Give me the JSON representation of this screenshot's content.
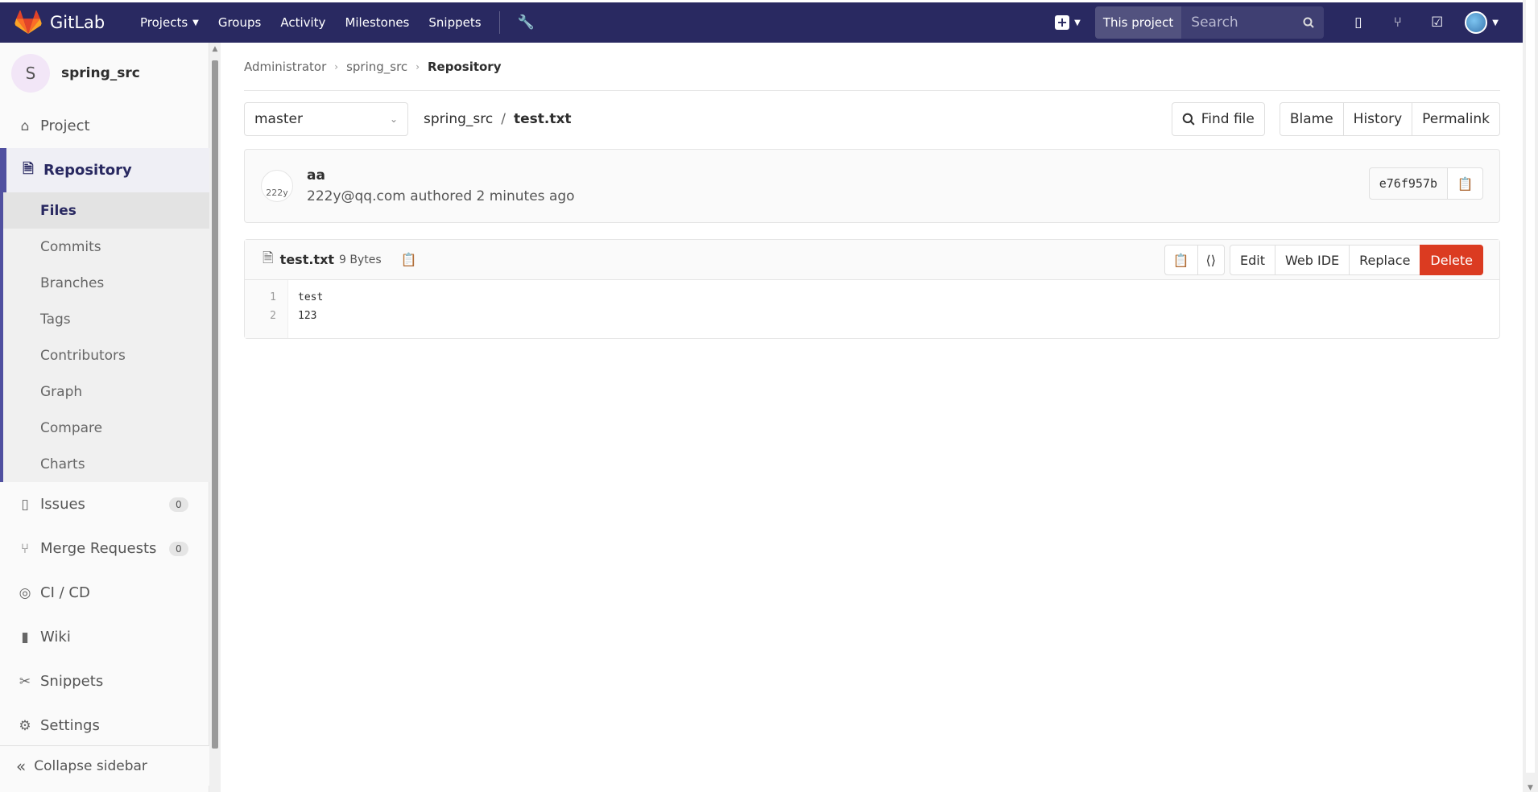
{
  "topnav": {
    "brand": "GitLab",
    "links": [
      {
        "label": "Projects",
        "has_dropdown": true
      },
      {
        "label": "Groups"
      },
      {
        "label": "Activity"
      },
      {
        "label": "Milestones"
      },
      {
        "label": "Snippets"
      }
    ],
    "search_scope": "This project",
    "search_placeholder": "Search"
  },
  "sidebar": {
    "project_avatar": "S",
    "project_name": "spring_src",
    "items": [
      {
        "label": "Project",
        "icon": "home-icon"
      },
      {
        "label": "Repository",
        "icon": "document-icon",
        "active": true
      },
      {
        "label": "Issues",
        "icon": "issues-icon",
        "badge": "0"
      },
      {
        "label": "Merge Requests",
        "icon": "merge-request-icon",
        "badge": "0"
      },
      {
        "label": "CI / CD",
        "icon": "rocket-icon"
      },
      {
        "label": "Wiki",
        "icon": "book-icon"
      },
      {
        "label": "Snippets",
        "icon": "scissors-icon"
      },
      {
        "label": "Settings",
        "icon": "gear-icon"
      }
    ],
    "repository_subitems": [
      "Files",
      "Commits",
      "Branches",
      "Tags",
      "Contributors",
      "Graph",
      "Compare",
      "Charts"
    ],
    "current_subitem": "Files",
    "collapse_label": "Collapse sidebar"
  },
  "breadcrumb": {
    "items": [
      "Administrator",
      "spring_src",
      "Repository"
    ]
  },
  "file_nav": {
    "branch": "master",
    "path_root": "spring_src",
    "path_sep": "/",
    "file_name": "test.txt",
    "find_file": "Find file",
    "blame": "Blame",
    "history": "History",
    "permalink": "Permalink"
  },
  "commit": {
    "avatar_alt": "222y",
    "title": "aa",
    "meta": "222y@qq.com authored 2 minutes ago",
    "sha": "e76f957b"
  },
  "file": {
    "name": "test.txt",
    "size": "9 Bytes",
    "actions": {
      "edit": "Edit",
      "web_ide": "Web IDE",
      "replace": "Replace",
      "delete": "Delete"
    },
    "line_numbers": [
      "1",
      "2"
    ],
    "lines": [
      "test",
      "123"
    ]
  },
  "colors": {
    "nav_bg": "#292961",
    "delete_red": "#db3b21",
    "sidebar_accent": "#5050a0"
  }
}
